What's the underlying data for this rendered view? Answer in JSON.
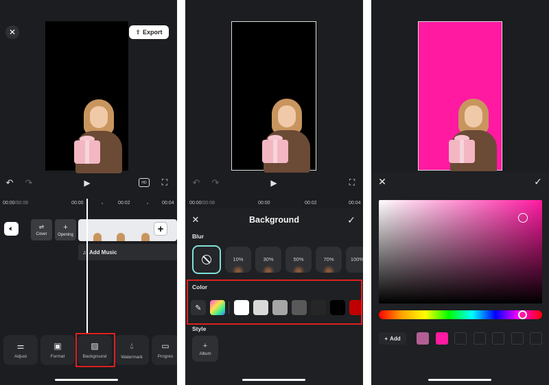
{
  "editor": {
    "export_label": "Export",
    "time_current": "00:00",
    "time_total": "/00:08",
    "ruler": [
      "00:00",
      "00:02",
      "00:04"
    ],
    "cover_label": "Cover",
    "opening_label": "Opening",
    "add_music_label": "Add Music",
    "tools": [
      {
        "label": "Adjust",
        "icon": "sliders-icon"
      },
      {
        "label": "Format",
        "icon": "format-icon"
      },
      {
        "label": "Background",
        "icon": "background-icon"
      },
      {
        "label": "Watermark",
        "icon": "watermark-icon"
      },
      {
        "label": "Progres",
        "icon": "progress-icon"
      }
    ]
  },
  "background_panel": {
    "title": "Background",
    "time_current": "00:00",
    "time_total": "/00:08",
    "ruler": [
      "00:00",
      "00:02",
      "00:04"
    ],
    "blur_label": "Blur",
    "blur_options": [
      "10%",
      "30%",
      "50%",
      "70%",
      "100%"
    ],
    "color_label": "Color",
    "color_swatches": [
      "#ffffff",
      "#d9d9d9",
      "#a6a6a6",
      "#595959",
      "#262626",
      "#000000",
      "#c00000"
    ],
    "style_label": "Style",
    "album_label": "Album"
  },
  "color_picker": {
    "selected_color": "#ff1aa1",
    "add_label": "Add",
    "saved_colors": [
      "#b35f95",
      "#ff1aa1"
    ]
  },
  "colors": {
    "highlight": "#e02020",
    "selected_ring": "#7fe0d8",
    "panel_bg": "#1b1d20"
  }
}
